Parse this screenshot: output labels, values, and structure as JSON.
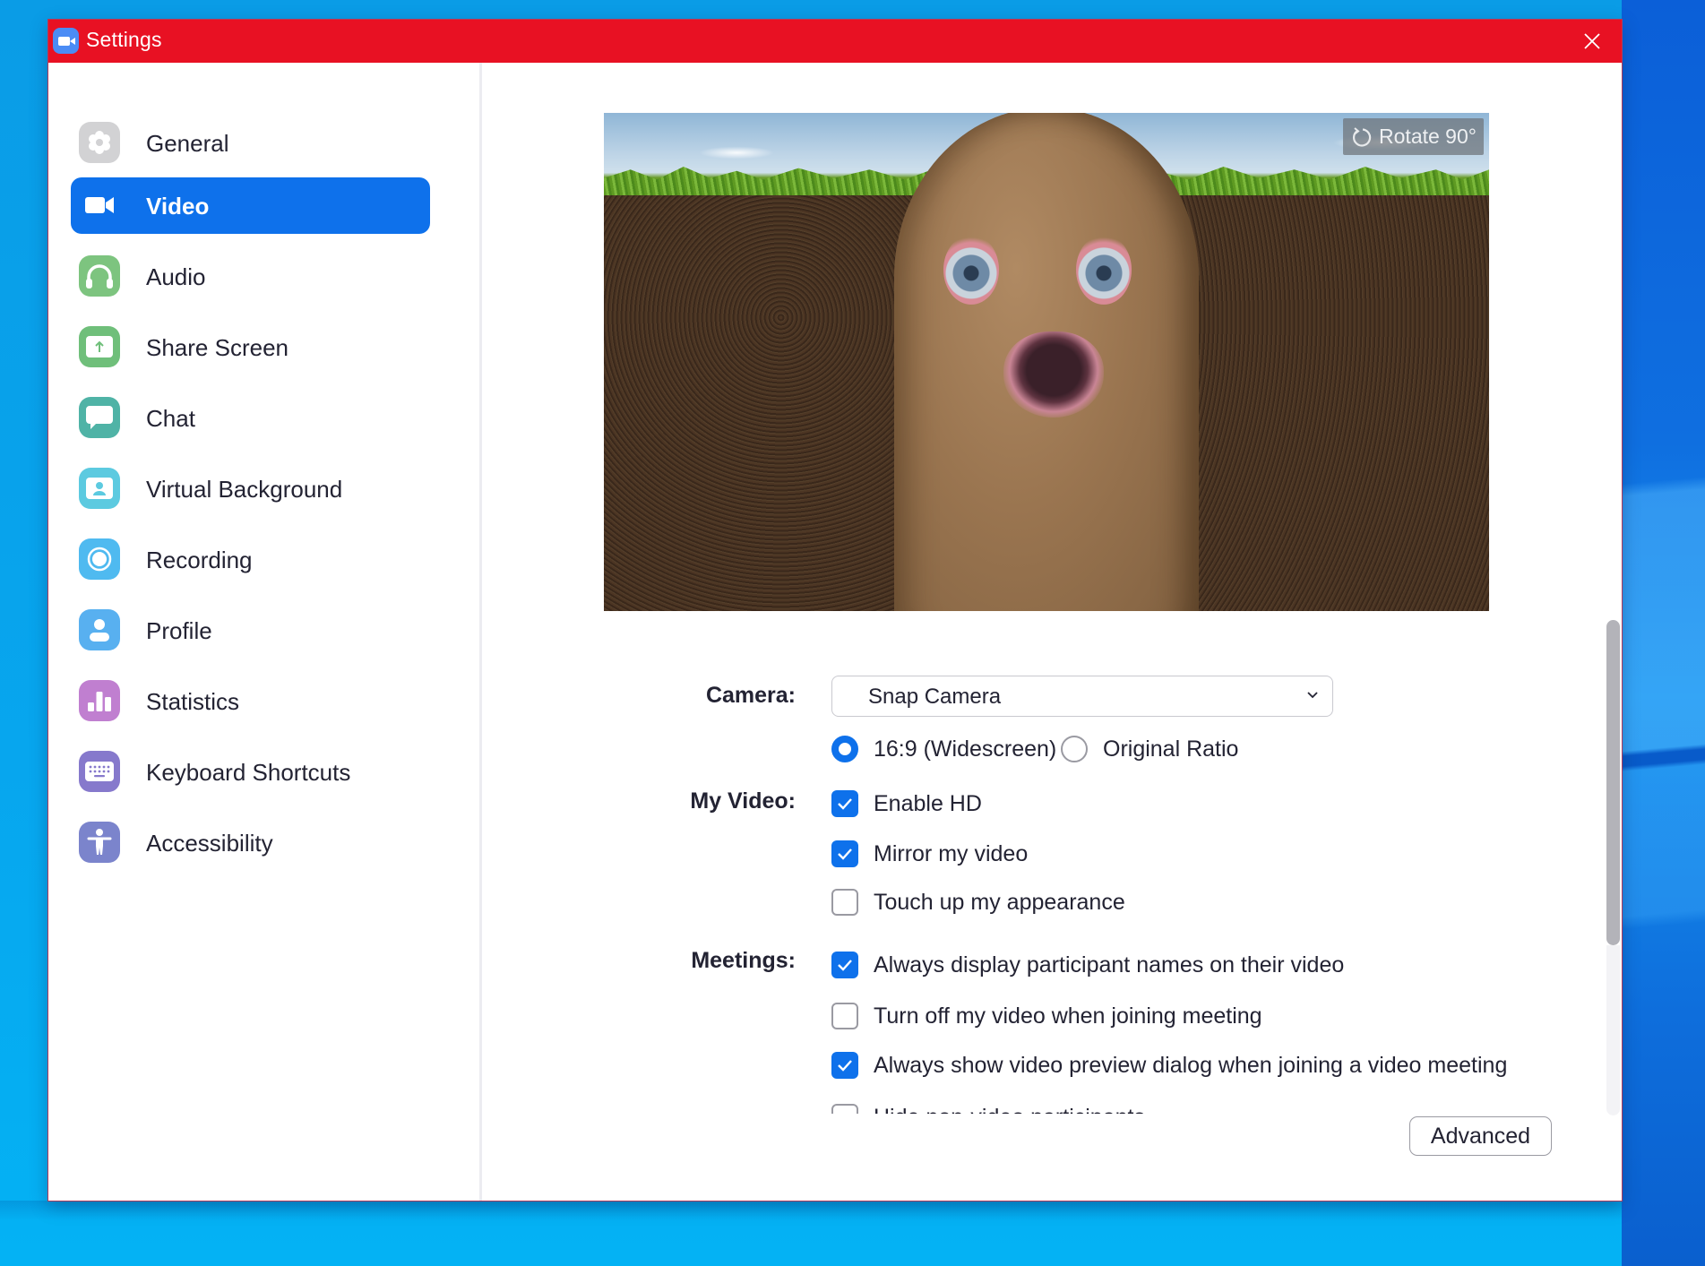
{
  "window": {
    "title": "Settings",
    "app_icon": "zoom-camera-icon",
    "close_icon": "close-icon",
    "titlebar_color": "#e81123"
  },
  "sidebar": {
    "selected": "Video",
    "accent_color": "#0e71eb",
    "items": [
      {
        "label": "General",
        "icon": "gear-icon",
        "color": "#cfcfcf",
        "active": false
      },
      {
        "label": "Video",
        "icon": "video-camera-icon",
        "color": "#0e71eb",
        "active": true
      },
      {
        "label": "Audio",
        "icon": "headphones-icon",
        "color": "#7dc47f",
        "active": false
      },
      {
        "label": "Share Screen",
        "icon": "share-screen-icon",
        "color": "#6fbf7a",
        "active": false
      },
      {
        "label": "Chat",
        "icon": "chat-bubble-icon",
        "color": "#4fb3a6",
        "active": false
      },
      {
        "label": "Virtual Background",
        "icon": "virtual-background-icon",
        "color": "#5ccae0",
        "active": false
      },
      {
        "label": "Recording",
        "icon": "record-icon",
        "color": "#4fbaf0",
        "active": false
      },
      {
        "label": "Profile",
        "icon": "profile-icon",
        "color": "#58b0f0",
        "active": false
      },
      {
        "label": "Statistics",
        "icon": "bar-chart-icon",
        "color": "#c07fd0",
        "active": false
      },
      {
        "label": "Keyboard Shortcuts",
        "icon": "keyboard-icon",
        "color": "#8679cc",
        "active": false
      },
      {
        "label": "Accessibility",
        "icon": "accessibility-icon",
        "color": "#7b84cc",
        "active": false
      }
    ]
  },
  "preview": {
    "description": "Camera preview showing a cartoon potato face filter over grass and soil background",
    "rotate_label": "Rotate 90°"
  },
  "camera": {
    "label": "Camera:",
    "selected": "Snap Camera",
    "aspect_options": [
      {
        "label": "16:9 (Widescreen)",
        "selected": true
      },
      {
        "label": "Original Ratio",
        "selected": false
      }
    ]
  },
  "my_video": {
    "label": "My Video:",
    "options": [
      {
        "label": "Enable HD",
        "checked": true
      },
      {
        "label": "Mirror my video",
        "checked": true
      },
      {
        "label": "Touch up my appearance",
        "checked": false
      }
    ]
  },
  "meetings": {
    "label": "Meetings:",
    "options": [
      {
        "label": "Always display participant names on their video",
        "checked": true
      },
      {
        "label": "Turn off my video when joining meeting",
        "checked": false
      },
      {
        "label": "Always show video preview dialog when joining a video meeting",
        "checked": true
      },
      {
        "label": "Hide non-video participants",
        "checked": false
      }
    ]
  },
  "footer": {
    "advanced_label": "Advanced"
  }
}
